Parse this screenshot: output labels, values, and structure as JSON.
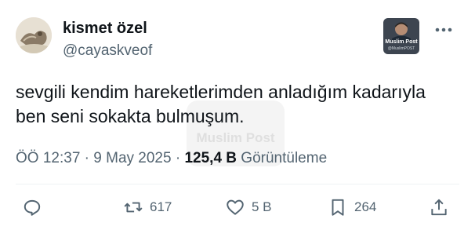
{
  "author": {
    "display_name": "kismet özel",
    "handle": "@cayaskveof",
    "avatar_icon": "profile-photo"
  },
  "header_badge": {
    "title": "Muslim Post",
    "subtitle": "@MuslimPOST"
  },
  "more_icon": "more-horizontal-icon",
  "tweet": {
    "lines": [
      "sevgili kendim hareketlerimden anladığım kadarıyla",
      "ben seni sokakta bulmuşum."
    ]
  },
  "watermark": "Muslim Post",
  "meta": {
    "time": "ÖÖ 12:37",
    "separator": "·",
    "date": "9 May 2025",
    "views_count": "125,4 B",
    "views_label": "Görüntüleme"
  },
  "actions": {
    "reply_icon": "reply-icon",
    "retweet_count": "617",
    "like_count": "5 B",
    "bookmark_count": "264",
    "share_icon": "share-icon"
  },
  "colors": {
    "text_primary": "#0f1419",
    "text_secondary": "#536471",
    "divider": "#eff3f4"
  }
}
